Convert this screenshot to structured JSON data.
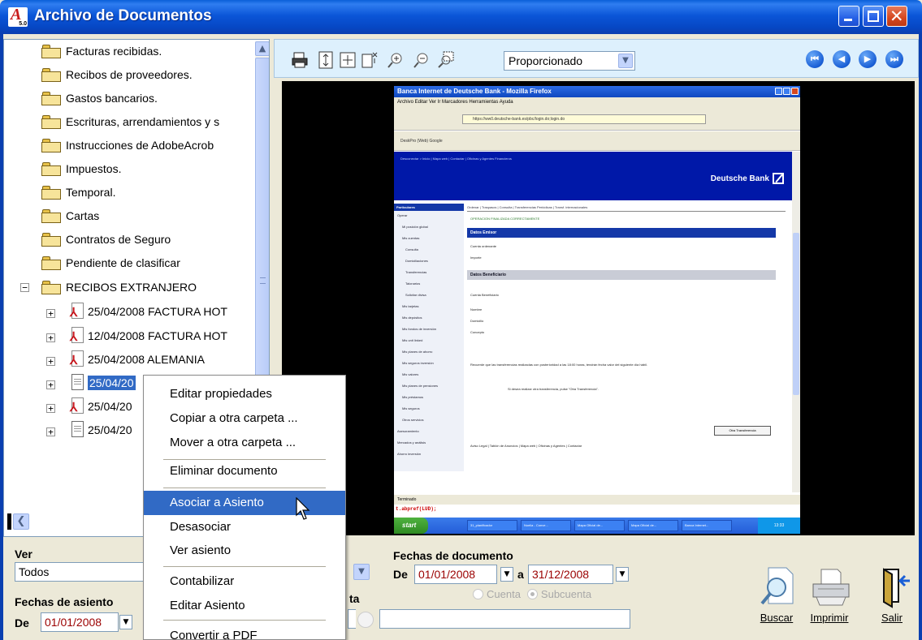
{
  "window": {
    "title": "Archivo de Documentos",
    "logo_letter": "A",
    "logo_version": "5.0"
  },
  "tree": {
    "folders": [
      "Facturas recibidas.",
      "Recibos de proveedores.",
      "Gastos bancarios.",
      "Escrituras, arrendamientos y s",
      "Instrucciones de AdobeAcrob",
      "Impuestos.",
      "Temporal.",
      "Cartas",
      "Contratos de Seguro",
      "Pendiente de clasificar",
      "RECIBOS EXTRANJERO"
    ],
    "expanded_folder_expander": "−",
    "documents": [
      {
        "label": "25/04/2008 FACTURA HOT",
        "type": "pdf"
      },
      {
        "label": "12/04/2008 FACTURA HOT",
        "type": "pdf"
      },
      {
        "label": "25/04/2008 ALEMANIA",
        "type": "pdf"
      },
      {
        "label": "25/04/20",
        "type": "doc",
        "selected": true
      },
      {
        "label": "25/04/20",
        "type": "pdf"
      },
      {
        "label": "25/04/20",
        "type": "doc"
      }
    ],
    "expander_glyph": "+"
  },
  "toolbar": {
    "zoom_value": "Proporcionado",
    "icons": [
      "print-icon",
      "fit-height-icon",
      "fit-page-icon",
      "copy-page-icon",
      "zoom-in-icon",
      "zoom-out-icon",
      "zoom-selection-icon"
    ],
    "nav": [
      "first-page-icon",
      "previous-page-icon",
      "next-page-icon",
      "last-page-icon"
    ]
  },
  "document_preview": {
    "browser_title": "Banca Internet de Deutsche Bank - Mozilla Firefox",
    "browser_menu": "Archivo  Editar  Ver  Ir  Marcadores  Herramientas  Ayuda",
    "url": "https://ww0.deutsche-bank.es/pbc/login.do;login.do",
    "bookmarks": "DeskPro (Web)   Google",
    "bank_links": "Desconectar >         Inicio | Mapa web | Contactar | Oficinas y Agentes Financieros",
    "bank_name": "Deutsche Bank",
    "sidebar_head": "Particulares",
    "sidebar_items": [
      "Operar",
      "Mi posición global",
      "Mis cuentas",
      "Consulta",
      "Domiciliaciones",
      "Transferencias",
      "Talonarios",
      "Solicitar divisa",
      "Mis tarjetas",
      "Mis depósitos",
      "Mis fondos de inversión",
      "Mis unit linked",
      "Mis planes de ahorro",
      "Mis seguros inversión",
      "Mis valores",
      "Mis planes de pensiones",
      "Mis préstamos",
      "Mis seguros",
      "Otros servicios",
      "Asesoramiento",
      "Mercados y análisis",
      "Ahorro inversión"
    ],
    "tabs": "Ordenar | Traspasos | Consulta | Transferencias Periódicas | Transf. internacionales",
    "success_msg": "OPERACION FINALIZADA CORRECTAMENTE",
    "section_emisor": "Datos Emisor",
    "rows_emisor": [
      "Cuenta ordenante",
      "Importe"
    ],
    "section_beneficiario": "Datos Beneficiario",
    "rows_beneficiario": [
      "Cuenta Beneficiario",
      "Nombre",
      "Domicilio",
      "Concepto"
    ],
    "note": "Recuerde que las transferencias realizadas con posterioridad a las 18:00 horas, tendrán fecha valor del siguiente día hábil.",
    "question": "Si desea realizar otra transferencia, pulse \"Otra Transferencia\".",
    "button": "Otra Transferencia",
    "footer_links": "Aviso Legal | Tablón de Anuncios | Mapa web | Oficinas y Agentes | Contactar",
    "status": "Terminado",
    "js_text": "t.abpref(LUD);",
    "taskbar_start": "start",
    "taskbar_tasks": [
      "31_planificador",
      "Noelia - Conve...",
      "Mapa Oficial de...",
      "Mapa Oficial de...",
      "Banca Internet..."
    ],
    "tray_time": "13:33"
  },
  "filters": {
    "ver_label": "Ver",
    "ver_value": "Todos",
    "fechas_asiento_label": "Fechas de asiento",
    "de_label": "De",
    "asiento_desde": "01/01/2008",
    "fechas_documento_label": "Fechas de documento",
    "doc_desde": "01/01/2008",
    "a_label": "a",
    "doc_hasta": "31/12/2008",
    "cuenta_partial_label": "ta",
    "radio_cuenta": "Cuenta",
    "radio_subcuenta": "Subcuenta"
  },
  "actions": {
    "buscar": "Buscar",
    "imprimir": "Imprimir",
    "salir": "Salir"
  },
  "context_menu": [
    "Editar propiedades",
    "Copiar a otra carpeta ...",
    "Mover a otra carpeta ...",
    "Eliminar documento",
    "Asociar a Asiento",
    "Desasociar",
    "Ver asiento",
    "Contabilizar",
    "Editar Asiento",
    "Convertir a PDF"
  ],
  "colors": {
    "titlebar": "#0A5FD8",
    "selection": "#316AC5",
    "date_text": "#9B0000",
    "viewer_toolbar": "#DDF0FD",
    "deutsche_blue": "#0018A8"
  }
}
